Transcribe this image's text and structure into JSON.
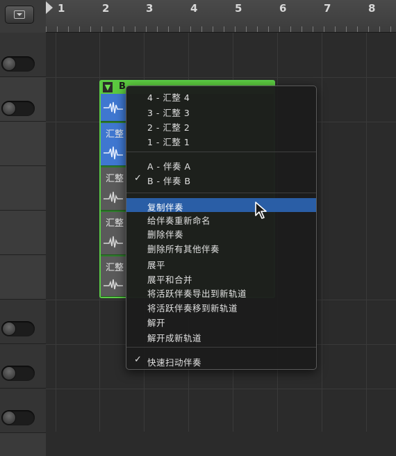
{
  "ruler": {
    "bars": [
      "1",
      "2",
      "3",
      "4",
      "5",
      "6",
      "7",
      "8"
    ]
  },
  "region": {
    "header_letter": "B"
  },
  "take_lanes": [
    {
      "label": ""
    },
    {
      "label": "汇整"
    },
    {
      "label": "汇整"
    },
    {
      "label": "汇整"
    },
    {
      "label": "汇整"
    }
  ],
  "menu": {
    "takes": [
      {
        "label": "4 - 汇整 4",
        "checked": false
      },
      {
        "label": "3 - 汇整 3",
        "checked": false
      },
      {
        "label": "2 - 汇整 2",
        "checked": false
      },
      {
        "label": "1 - 汇整 1",
        "checked": false
      }
    ],
    "comps": [
      {
        "label": "A - 伴奏 A",
        "checked": false
      },
      {
        "label": "B - 伴奏 B",
        "checked": true
      }
    ],
    "actions": [
      {
        "label": "复制伴奏",
        "highlighted": true
      },
      {
        "label": "给伴奏重新命名"
      },
      {
        "label": "删除伴奏"
      },
      {
        "label": "删除所有其他伴奏"
      },
      {
        "label": "展平"
      },
      {
        "label": "展平和合并"
      },
      {
        "label": "将活跃伴奏导出到新轨道"
      },
      {
        "label": "将活跃伴奏移到新轨道"
      },
      {
        "label": "解开"
      },
      {
        "label": "解开成新轨道"
      }
    ],
    "quick_swipe": {
      "label": "快速扫动伴奏",
      "checked": true
    },
    "checkmark": "✓"
  },
  "colors": {
    "region_green": "#5bc93f",
    "highlight_blue": "#2a5ea6",
    "take_blue": "#3f77d0"
  }
}
